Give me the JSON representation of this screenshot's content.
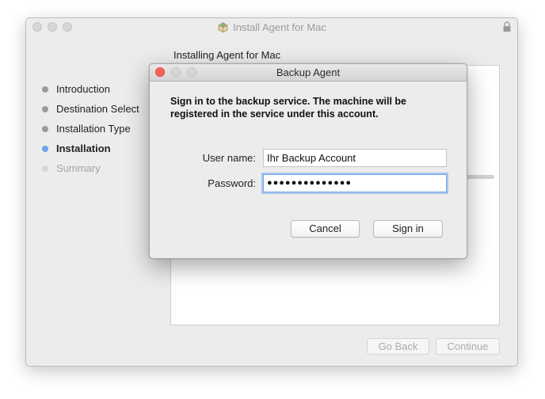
{
  "installer": {
    "title": "Install Agent for Mac",
    "heading": "Installing Agent for Mac",
    "steps": [
      {
        "label": "Introduction",
        "state": "done"
      },
      {
        "label": "Destination Select",
        "state": "done"
      },
      {
        "label": "Installation Type",
        "state": "done"
      },
      {
        "label": "Installation",
        "state": "current"
      },
      {
        "label": "Summary",
        "state": "future"
      }
    ],
    "go_back_label": "Go Back",
    "continue_label": "Continue"
  },
  "dialog": {
    "title": "Backup Agent",
    "message": "Sign in to the backup service. The machine will be registered in the service under this account.",
    "username_label": "User name:",
    "username_value": "Ihr Backup Account",
    "password_label": "Password:",
    "password_value": "●●●●●●●●●●●●●●",
    "cancel_label": "Cancel",
    "signin_label": "Sign in"
  },
  "colors": {
    "current_step_dot": "#6ea2ea",
    "close_button": "#fc605c",
    "focus_ring": "#a7c5f0"
  },
  "icons": [
    "package-icon",
    "lock-icon"
  ]
}
